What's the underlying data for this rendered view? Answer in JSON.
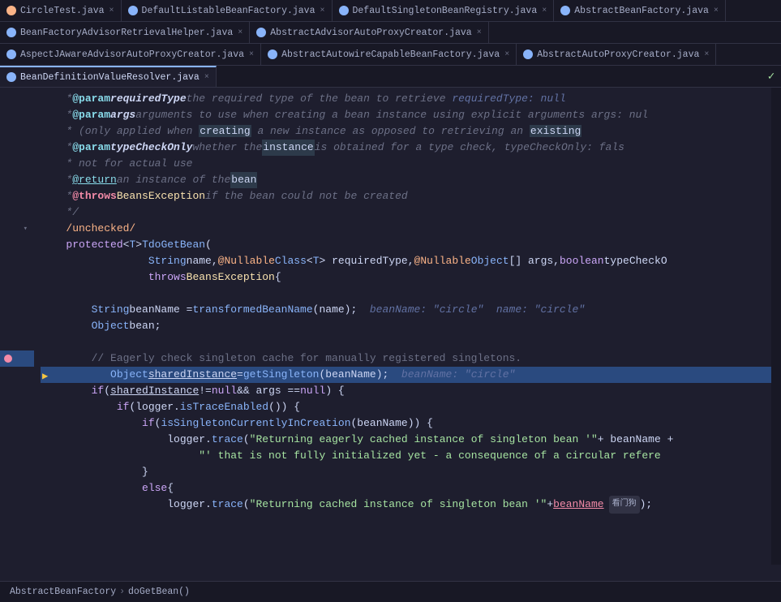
{
  "tabs_row1": [
    {
      "label": "CircleTest.java",
      "icon": "orange",
      "active": false,
      "closeable": true
    },
    {
      "label": "DefaultListableBeanFactory.java",
      "icon": "blue",
      "active": false,
      "closeable": true
    },
    {
      "label": "DefaultSingletonBeanRegistry.java",
      "icon": "blue",
      "active": false,
      "closeable": true
    },
    {
      "label": "AbstractBeanFactory.java",
      "icon": "blue",
      "active": false,
      "closeable": true
    }
  ],
  "tabs_row2": [
    {
      "label": "BeanFactoryAdvisorRetrievalHelper.java",
      "icon": "blue",
      "active": false,
      "closeable": true
    },
    {
      "label": "AbstractAdvisorAutoProxyCreator.java",
      "icon": "blue",
      "active": false,
      "closeable": true
    }
  ],
  "tabs_row3": [
    {
      "label": "AspectJAwareAdvisorAutoProxyCreator.java",
      "icon": "blue",
      "active": false,
      "closeable": true
    },
    {
      "label": "AbstractAutowireCapableBeanFactory.java",
      "icon": "blue",
      "active": false,
      "closeable": true
    },
    {
      "label": "AbstractAutoProxyCreator.java",
      "icon": "blue",
      "active": false,
      "closeable": true
    }
  ],
  "tabs_row4": [
    {
      "label": "BeanDefinitionValueResolver.java",
      "icon": "blue",
      "active": true,
      "closeable": true
    }
  ],
  "code_lines": [
    {
      "num": "",
      "content": "comment_required_type"
    },
    {
      "num": "",
      "content": "comment_args"
    },
    {
      "num": "",
      "content": "comment_creating"
    },
    {
      "num": "",
      "content": "comment_type_check"
    },
    {
      "num": "",
      "content": "comment_return"
    },
    {
      "num": "",
      "content": "comment_throws"
    },
    {
      "num": "",
      "content": "comment_end"
    },
    {
      "num": "",
      "content": "unchecked"
    },
    {
      "num": "",
      "content": "method_sig"
    },
    {
      "num": "",
      "content": "method_params"
    },
    {
      "num": "",
      "content": "throws_line"
    },
    {
      "num": "",
      "content": "blank"
    },
    {
      "num": "",
      "content": "bean_name"
    },
    {
      "num": "",
      "content": "obj_bean"
    },
    {
      "num": "",
      "content": "blank2"
    },
    {
      "num": "",
      "content": "eagerly_comment"
    },
    {
      "num": "",
      "content": "shared_instance"
    },
    {
      "num": "",
      "content": "if_shared"
    },
    {
      "num": "",
      "content": "if_logger"
    },
    {
      "num": "",
      "content": "if_singleton"
    },
    {
      "num": "",
      "content": "logger_trace1"
    },
    {
      "num": "",
      "content": "logger_trace2"
    },
    {
      "num": "",
      "content": "close_brace1"
    },
    {
      "num": "",
      "content": "else_line"
    },
    {
      "num": "",
      "content": "logger_cached"
    }
  ],
  "status": {
    "breadcrumb_class": "AbstractBeanFactory",
    "breadcrumb_method": "doGetBean()",
    "sep": "›"
  }
}
